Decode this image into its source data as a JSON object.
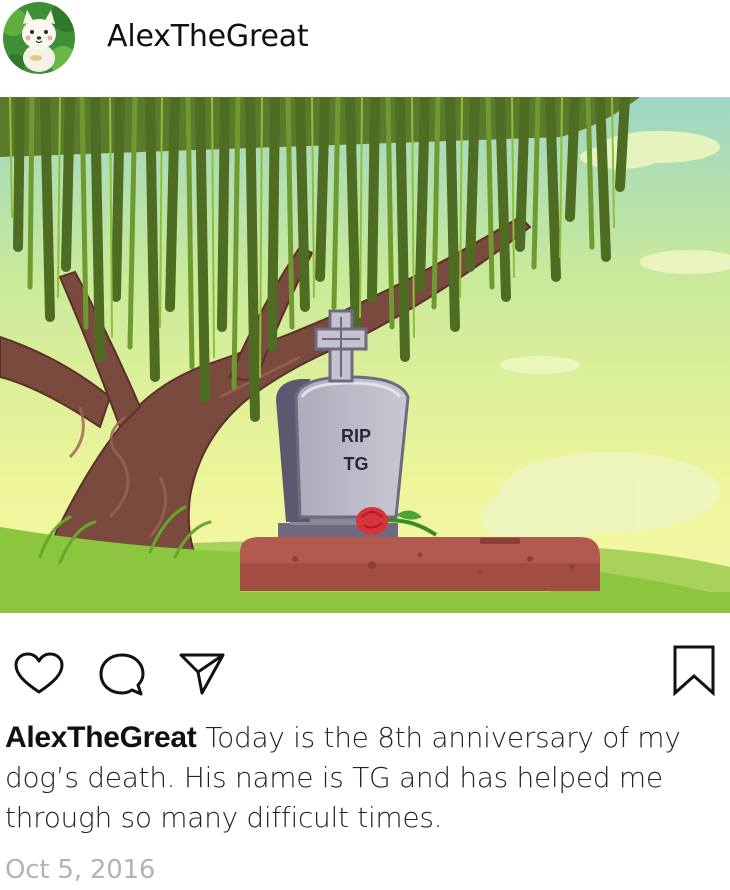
{
  "header": {
    "username": "AlexTheGreat",
    "avatar_icon": "white-dog-avatar"
  },
  "image": {
    "tombstone_line1": "RIP",
    "tombstone_line2": "TG"
  },
  "actions": {
    "like_icon": "heart-outline",
    "comment_icon": "speech-bubble-outline",
    "share_icon": "paper-plane-outline",
    "save_icon": "bookmark-outline"
  },
  "caption": {
    "username": "AlexTheGreat",
    "text": "Today is the 8th anniversary of my dog’s death. His name is TG and has helped me through so many difficult times."
  },
  "timestamp": "Oct 5, 2016",
  "colors": {
    "avatar_bg": "#4a9a3c",
    "tombstone": "#b9b7c4",
    "grave_dirt": "#b35a4e",
    "grass": "#8cc63f",
    "sky": "#d7ef8a",
    "rose": "#d8323a",
    "timestamp": "#b3b3b3"
  }
}
